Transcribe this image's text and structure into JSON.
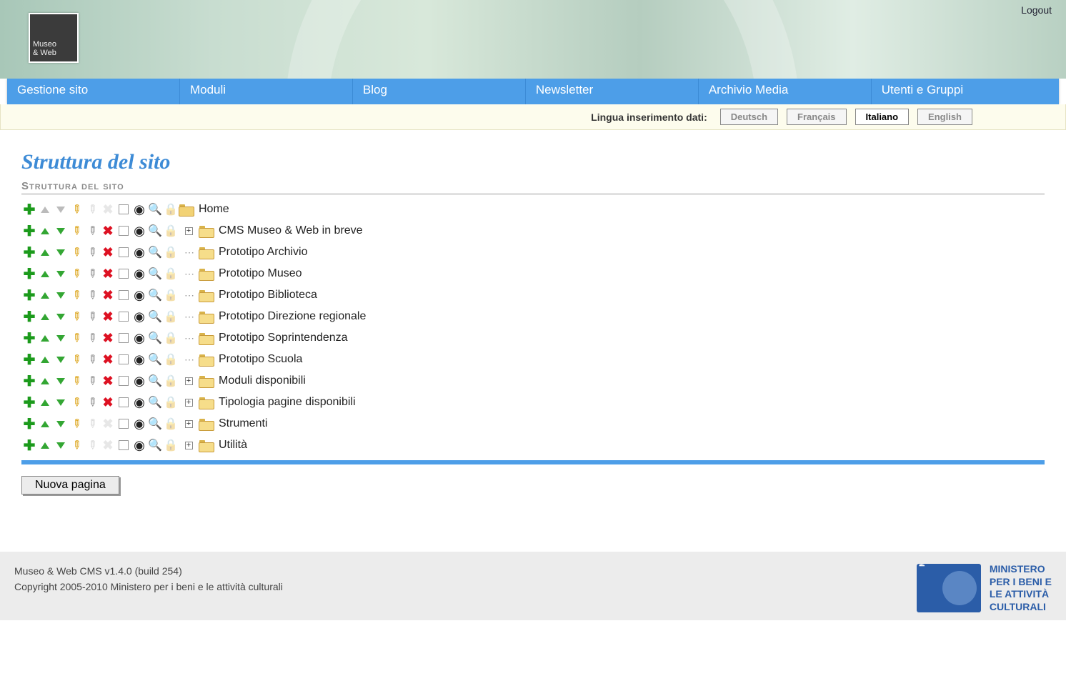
{
  "header": {
    "logo_line1": "Museo",
    "logo_line2": "& Web",
    "logout": "Logout"
  },
  "menu": [
    "Gestione sito",
    "Moduli",
    "Blog",
    "Newsletter",
    "Archivio Media",
    "Utenti e Gruppi"
  ],
  "lang": {
    "label": "Lingua inserimento dati:",
    "options": [
      "Deutsch",
      "Français",
      "Italiano",
      "English"
    ],
    "active": 2
  },
  "page": {
    "title": "Struttura del sito",
    "subhead": "Struttura del sito"
  },
  "tree": [
    {
      "label": "Home",
      "home": true,
      "expand": "none",
      "up": false,
      "down": false,
      "pencil2": false,
      "del": false,
      "eye": true
    },
    {
      "label": "CMS Museo & Web in breve",
      "expand": "plus",
      "up": true,
      "down": true,
      "pencil2": true,
      "del": true,
      "eye": true
    },
    {
      "label": "Prototipo Archivio",
      "expand": "dots",
      "up": true,
      "down": true,
      "pencil2": true,
      "del": true,
      "eye": true
    },
    {
      "label": "Prototipo Museo",
      "expand": "dots",
      "up": true,
      "down": true,
      "pencil2": true,
      "del": true,
      "eye": true
    },
    {
      "label": "Prototipo Biblioteca",
      "expand": "dots",
      "up": true,
      "down": true,
      "pencil2": true,
      "del": true,
      "eye": true
    },
    {
      "label": "Prototipo Direzione regionale",
      "expand": "dots",
      "up": true,
      "down": true,
      "pencil2": true,
      "del": true,
      "eye": true
    },
    {
      "label": "Prototipo Soprintendenza",
      "expand": "dots",
      "up": true,
      "down": true,
      "pencil2": true,
      "del": true,
      "eye": true
    },
    {
      "label": "Prototipo Scuola",
      "expand": "dots",
      "up": true,
      "down": true,
      "pencil2": true,
      "del": true,
      "eye": true
    },
    {
      "label": "Moduli disponibili",
      "expand": "plus",
      "up": true,
      "down": true,
      "pencil2": true,
      "del": true,
      "eye": true
    },
    {
      "label": "Tipologia pagine disponibili",
      "expand": "plus",
      "up": true,
      "down": true,
      "pencil2": true,
      "del": true,
      "eye": true
    },
    {
      "label": "Strumenti",
      "expand": "plus",
      "up": true,
      "down": true,
      "pencil2": false,
      "del": false,
      "eye": true
    },
    {
      "label": "Utilità",
      "expand": "plus",
      "up": true,
      "down": true,
      "pencil2": false,
      "del": false,
      "eye": true
    }
  ],
  "buttons": {
    "new_page": "Nuova pagina"
  },
  "footer": {
    "line1": "Museo & Web CMS v1.4.0 (build 254)",
    "line2": "Copyright 2005-2010 Ministero per i beni e le attività culturali",
    "ministry": "MINISTERO\nPER I BENI E\nLE ATTIVITÀ\nCULTURALI"
  }
}
